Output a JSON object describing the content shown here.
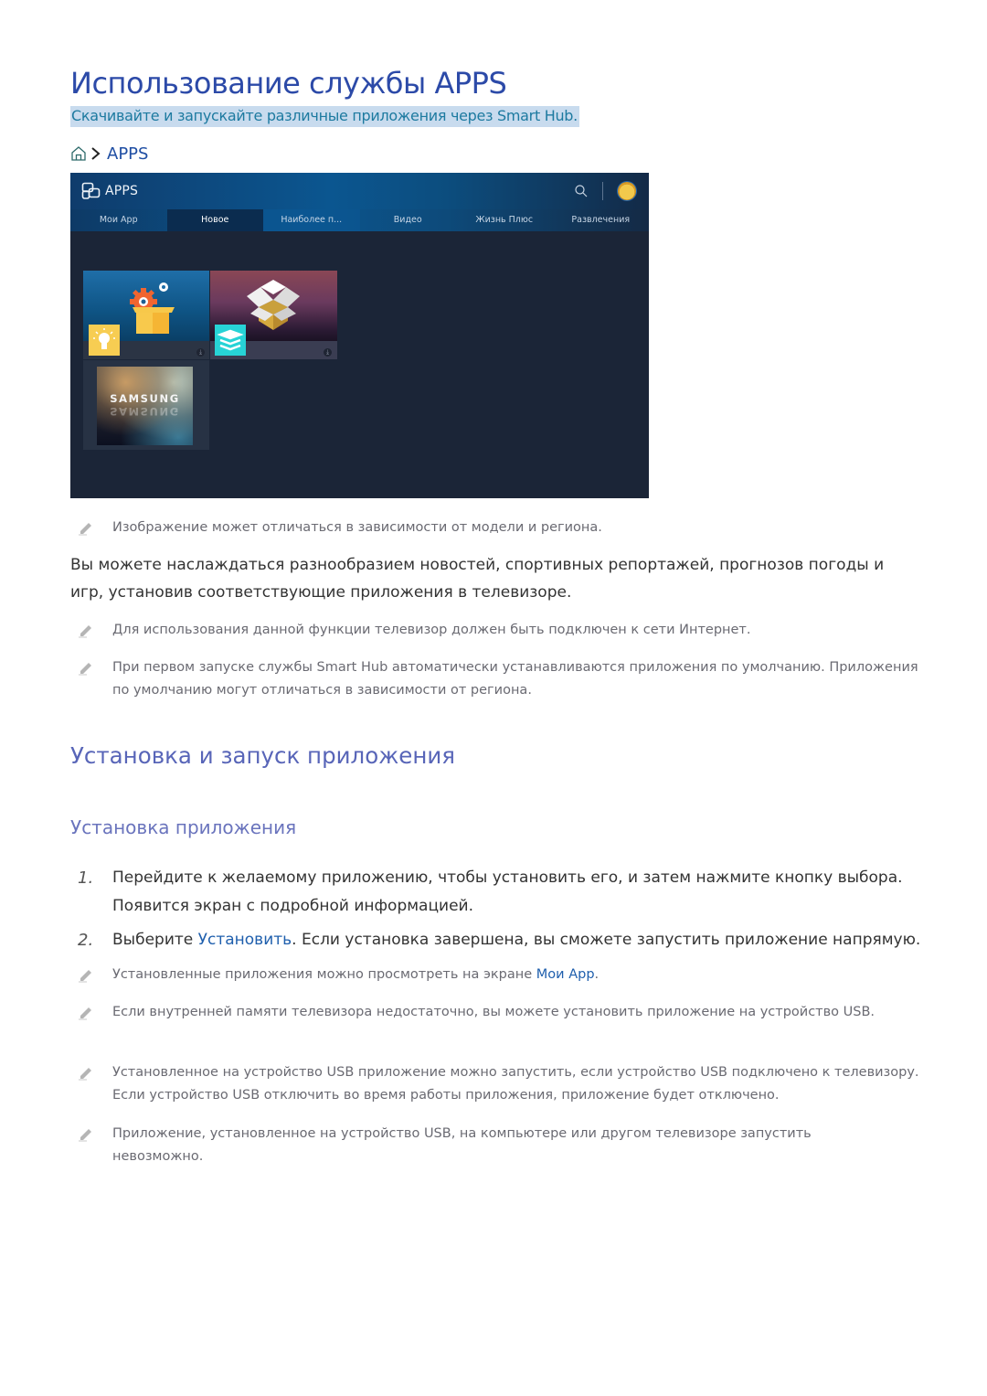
{
  "page": {
    "title": "Использование службы APPS",
    "subtitle": "Скачивайте и запускайте различные приложения через Smart Hub.",
    "breadcrumb": {
      "home_icon": "home-icon",
      "separator_icon": "chevron-right-icon",
      "label": "APPS"
    }
  },
  "tv_screen": {
    "app_title": "APPS",
    "logo_icon": "apps-logo-icon",
    "search_icon": "search-icon",
    "avatar_icon": "profile-avatar-icon",
    "tabs": [
      {
        "label": "Мои App",
        "active": false
      },
      {
        "label": "Новое",
        "active": true
      },
      {
        "label": "Наиболее п...",
        "active": false
      },
      {
        "label": "Видео",
        "active": false
      },
      {
        "label": "Жизнь Плюс",
        "active": false
      },
      {
        "label": "Развлечения",
        "active": false
      }
    ],
    "tiles": [
      {
        "name": "app-tile-1",
        "badge_icon": "lightbulb-icon",
        "status_icon": "download-icon"
      },
      {
        "name": "app-tile-2",
        "badge_icon": "layers-icon",
        "status_icon": "download-icon"
      },
      {
        "name": "app-tile-samsung",
        "text": "SAMSUNG"
      }
    ]
  },
  "notes_top": [
    "Изображение может отличаться в зависимости от модели и региона."
  ],
  "intro": "Вы можете наслаждаться разнообразием новостей, спортивных репортажей, прогнозов погоды и игр, установив соответствующие приложения в телевизоре.",
  "notes_mid": [
    "Для использования данной функции телевизор должен быть подключен к сети Интернет.",
    "При первом запуске службы Smart Hub автоматически устанавливаются приложения по умолчанию. Приложения по умолчанию могут отличаться в зависимости от региона."
  ],
  "section": {
    "heading": "Установка и запуск приложения",
    "subheading": "Установка приложения",
    "steps": [
      {
        "num": "1.",
        "text": "Перейдите к желаемому приложению, чтобы установить его, и затем нажмите кнопку выбора. Появится экран с подробной информацией."
      },
      {
        "num": "2.",
        "before": "Выберите ",
        "link": "Установить",
        "after": ". Если установка завершена, вы сможете запустить приложение напрямую."
      }
    ],
    "notes": [
      {
        "before": "Установленные приложения можно просмотреть на экране ",
        "link": "Мои App",
        "after": "."
      },
      {
        "text": "Если внутренней памяти телевизора недостаточно, вы можете установить приложение на устройство USB."
      },
      {
        "text": "Установленное на устройство USB приложение можно запустить, если устройство USB подключено к телевизору. Если устройство USB отключить во время работы приложения, приложение будет отключено."
      },
      {
        "text": "Приложение, установленное на устройство USB, на компьютере или другом телевизоре запустить невозможно."
      }
    ]
  },
  "colors": {
    "title": "#2c4aa8",
    "subtitle_text": "#1d7aa0",
    "subtitle_highlight": "#c8dbee",
    "heading": "#5865b8",
    "link": "#1f5fad",
    "tv_background": "#1b2537"
  }
}
